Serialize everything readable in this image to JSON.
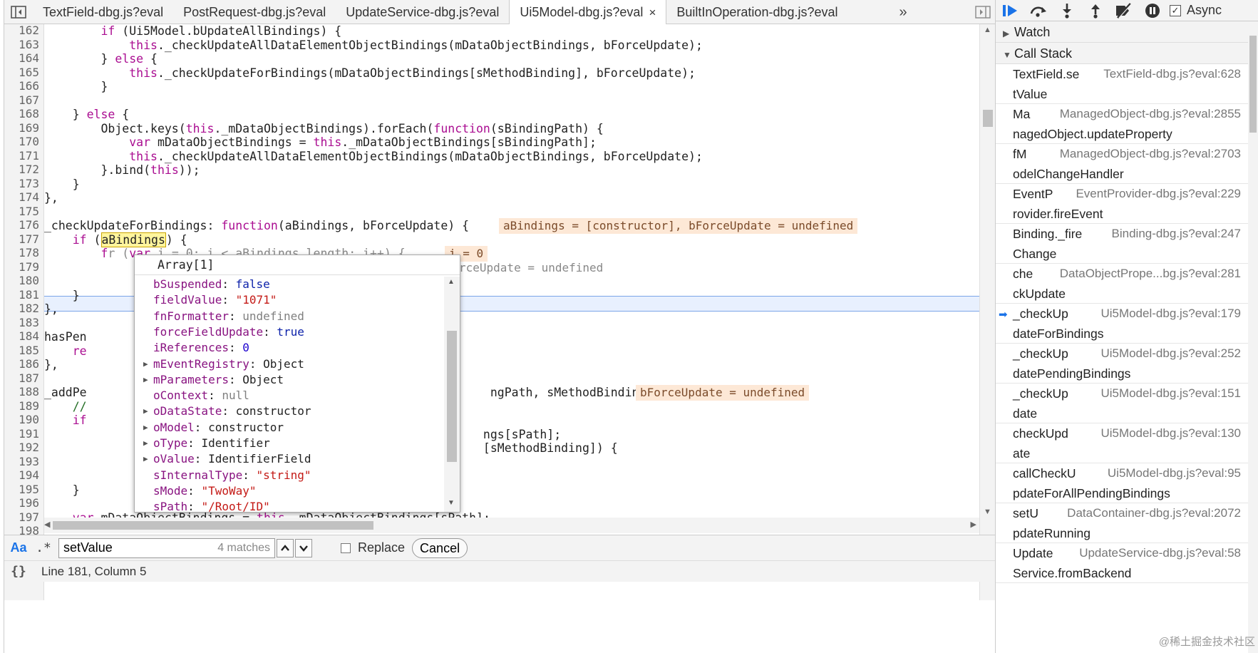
{
  "tabs": [
    {
      "label": "TextField-dbg.js?eval",
      "active": false
    },
    {
      "label": "PostRequest-dbg.js?eval",
      "active": false
    },
    {
      "label": "UpdateService-dbg.js?eval",
      "active": false
    },
    {
      "label": "Ui5Model-dbg.js?eval",
      "active": true
    },
    {
      "label": "BuiltInOperation-dbg.js?eval",
      "active": false
    }
  ],
  "tab_close_glyph": "×",
  "tab_overflow_glyph": "»",
  "line_numbers": [
    "162",
    "163",
    "164",
    "165",
    "166",
    "167",
    "168",
    "169",
    "170",
    "171",
    "172",
    "173",
    "174",
    "175",
    "176",
    "177",
    "178",
    "179",
    "180",
    "181",
    "182",
    "183",
    "184",
    "185",
    "186",
    "187",
    "188",
    "189",
    "190",
    "191",
    "192",
    "193",
    "194",
    "195",
    "196",
    "197",
    "198"
  ],
  "inline_values": {
    "l176": "aBindings = [constructor], bForceUpdate = undefined",
    "l178": "i = 0",
    "l179": "rceUpdate = undefined",
    "l188": "bForceUpdate = undefined"
  },
  "popover": {
    "title": "Array[1]",
    "props": [
      {
        "key": "bSuspended",
        "value": "false",
        "kind": "bool",
        "expandable": false
      },
      {
        "key": "fieldValue",
        "value": "\"1071\"",
        "kind": "str",
        "expandable": false
      },
      {
        "key": "fnFormatter",
        "value": "undefined",
        "kind": "null",
        "expandable": false
      },
      {
        "key": "forceFieldUpdate",
        "value": "true",
        "kind": "bool",
        "expandable": false
      },
      {
        "key": "iReferences",
        "value": "0",
        "kind": "num",
        "expandable": false
      },
      {
        "key": "mEventRegistry",
        "value": "Object",
        "kind": "obj",
        "expandable": true
      },
      {
        "key": "mParameters",
        "value": "Object",
        "kind": "obj",
        "expandable": true
      },
      {
        "key": "oContext",
        "value": "null",
        "kind": "null",
        "expandable": false
      },
      {
        "key": "oDataState",
        "value": "constructor",
        "kind": "obj",
        "expandable": true
      },
      {
        "key": "oModel",
        "value": "constructor",
        "kind": "obj",
        "expandable": true
      },
      {
        "key": "oType",
        "value": "Identifier",
        "kind": "obj",
        "expandable": true
      },
      {
        "key": "oValue",
        "value": "IdentifierField",
        "kind": "obj",
        "expandable": true
      },
      {
        "key": "sInternalType",
        "value": "\"string\"",
        "kind": "str",
        "expandable": false
      },
      {
        "key": "sMode",
        "value": "\"TwoWay\"",
        "kind": "str",
        "expandable": false
      },
      {
        "key": "sPath",
        "value": "\"/Root/ID\"",
        "kind": "str",
        "expandable": false
      }
    ]
  },
  "search": {
    "case_label": "Aa",
    "regex_label": ".*",
    "value": "setValue",
    "match_count": "4 matches",
    "replace_label": "Replace",
    "cancel_label": "Cancel"
  },
  "status": {
    "braces": "{}",
    "position": "Line 181, Column 5"
  },
  "debugger": {
    "async_label": "Async",
    "async_checked": true,
    "watch_label": "Watch",
    "callstack_label": "Call Stack",
    "frames": [
      {
        "name": "TextField.se",
        "loc": "TextField-dbg.js?eval:628",
        "name2": "tValue",
        "current": false
      },
      {
        "name": "Ma",
        "loc": "ManagedObject-dbg.js?eval:2855",
        "name2": "nagedObject.updateProperty",
        "current": false
      },
      {
        "name": "fM",
        "loc": "ManagedObject-dbg.js?eval:2703",
        "name2": "odelChangeHandler",
        "current": false
      },
      {
        "name": "EventP",
        "loc": "EventProvider-dbg.js?eval:229",
        "name2": "rovider.fireEvent",
        "current": false
      },
      {
        "name": "Binding._fire",
        "loc": "Binding-dbg.js?eval:247",
        "name2": "Change",
        "current": false
      },
      {
        "name": "che",
        "loc": "DataObjectPrope...bg.js?eval:281",
        "name2": "ckUpdate",
        "current": false
      },
      {
        "name": "_checkUp",
        "loc": "Ui5Model-dbg.js?eval:179",
        "name2": "dateForBindings",
        "current": true
      },
      {
        "name": "_checkUp",
        "loc": "Ui5Model-dbg.js?eval:252",
        "name2": "datePendingBindings",
        "current": false
      },
      {
        "name": "_checkUp",
        "loc": "Ui5Model-dbg.js?eval:151",
        "name2": "date",
        "current": false
      },
      {
        "name": "checkUpd",
        "loc": "Ui5Model-dbg.js?eval:130",
        "name2": "ate",
        "current": false
      },
      {
        "name": "callCheckU",
        "loc": "Ui5Model-dbg.js?eval:95",
        "name2": "pdateForAllPendingBindings",
        "current": false
      },
      {
        "name": "setU",
        "loc": "DataContainer-dbg.js?eval:2072",
        "name2": "pdateRunning",
        "current": false
      },
      {
        "name": "Update",
        "loc": "UpdateService-dbg.js?eval:58",
        "name2": "Service.fromBackend",
        "current": false
      }
    ],
    "watermark": "@稀土掘金技术社区"
  },
  "colors": {
    "accent": "#1a73e8",
    "exec_line": "#e8f0fe",
    "inline_value_bg": "#fde8d6",
    "keyword": "#aa0d91"
  }
}
